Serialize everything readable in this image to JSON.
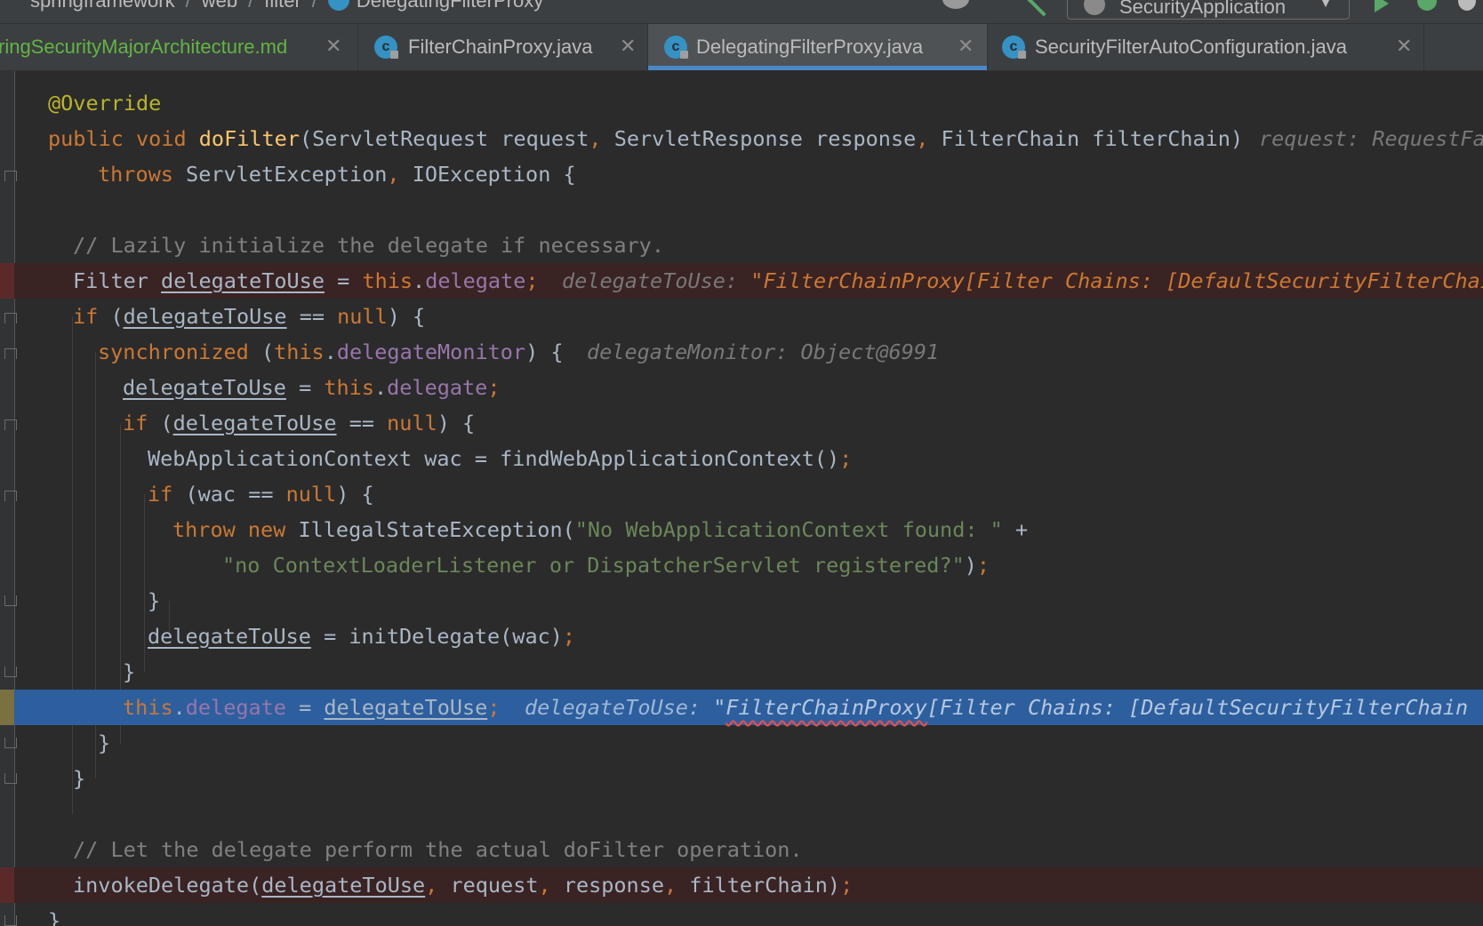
{
  "navbar": {
    "crumbs": [
      "springframework",
      "web",
      "filter",
      "DelegatingFilterProxy"
    ],
    "run_config": "SecurityApplication"
  },
  "tabs": [
    {
      "label": "ringSecurityMajorArchitecture.md",
      "active": false
    },
    {
      "label": "FilterChainProxy.java",
      "active": false
    },
    {
      "label": "DelegatingFilterProxy.java",
      "active": true
    },
    {
      "label": "SecurityFilterAutoConfiguration.java",
      "active": false
    }
  ],
  "tab_close_glyph": "✕",
  "tab_class_glyph": "c",
  "code": {
    "l1": "@Override",
    "l2a": "public void ",
    "l2b": "doFilter",
    "l2c": "(ServletRequest request",
    "l2d": ", ",
    "l2e": "ServletResponse response",
    "l2f": ", ",
    "l2g": "FilterChain filterChain)",
    "l2hint": "request: RequestFa",
    "l3a": "throws ",
    "l3b": "ServletException",
    "l3c": ", ",
    "l3d": "IOException {",
    "l5": "// Lazily initialize the delegate if necessary.",
    "l6a": "Filter ",
    "l6b": "delegateToUse",
    "l6c": " = ",
    "l6d": "this",
    "l6e": ".",
    "l6f": "delegate",
    "l6g": ";",
    "l6hintk": "delegateToUse: ",
    "l6hintv": "\"FilterChainProxy[Filter Chains: [DefaultSecurityFilterChai",
    "l7a": "if ",
    "l7b": "(",
    "l7c": "delegateToUse",
    "l7d": " == ",
    "l7e": "null",
    "l7f": ") {",
    "l8a": "synchronized ",
    "l8b": "(",
    "l8c": "this",
    "l8d": ".",
    "l8e": "delegateMonitor",
    "l8f": ") {",
    "l8hint": "delegateMonitor: Object@6991",
    "l9a": "delegateToUse",
    "l9b": " = ",
    "l9c": "this",
    "l9d": ".",
    "l9e": "delegate",
    "l9f": ";",
    "l10a": "if ",
    "l10b": "(",
    "l10c": "delegateToUse",
    "l10d": " == ",
    "l10e": "null",
    "l10f": ") {",
    "l11a": "WebApplicationContext wac = findWebApplicationContext()",
    "l11b": ";",
    "l12a": "if ",
    "l12b": "(wac == ",
    "l12c": "null",
    "l12d": ") {",
    "l13a": "throw new ",
    "l13b": "IllegalStateException(",
    "l13c": "\"No WebApplicationContext found: \"",
    "l13d": " +",
    "l14a": "\"no ContextLoaderListener or DispatcherServlet registered?\"",
    "l14b": ")",
    "l14c": ";",
    "l15": "}",
    "l16a": "delegateToUse",
    "l16b": " = initDelegate(wac)",
    "l16c": ";",
    "l17": "}",
    "l18a": "this",
    "l18b": ".",
    "l18c": "delegate",
    "l18d": " = ",
    "l18e": "delegateToUse",
    "l18f": ";",
    "l18hintk": "delegateToUse: ",
    "l18hintq": "\"",
    "l18hintv1": "FilterChainProxy",
    "l18hintv2": "[Filter Chains: [DefaultSecurityFilterChain [",
    "l19": "}",
    "l20": "}",
    "l22": "// Let the delegate perform the actual doFilter operation.",
    "l23a": "invokeDelegate(",
    "l23b": "delegateToUse",
    "l23c": ", ",
    "l23d": "request",
    "l23e": ", ",
    "l23f": "response",
    "l23g": ", ",
    "l23h": "filterChain)",
    "l23i": ";",
    "l24": "}"
  }
}
